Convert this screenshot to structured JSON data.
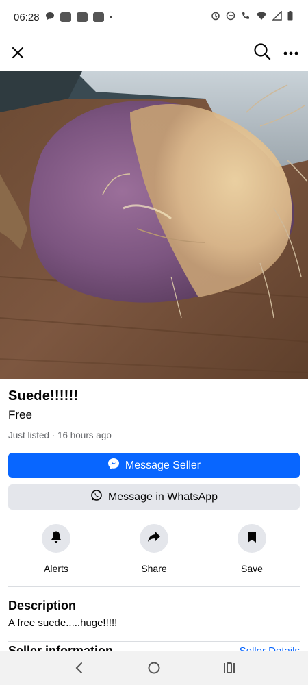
{
  "status_bar": {
    "time": "06:28",
    "left_icons": [
      "chat-bubble-icon",
      "app-notification-icon",
      "app-notification-icon",
      "app-notification-icon",
      "dot-icon"
    ],
    "right_icons": [
      "alarm-icon",
      "do-not-disturb-icon",
      "wifi-call-icon",
      "wifi-icon",
      "signal-icon",
      "battery-icon"
    ]
  },
  "top_bar": {
    "close_icon": "close-icon",
    "search_icon": "search-icon",
    "more_icon": "more-icon"
  },
  "listing": {
    "title": "Suede!!!!!!",
    "price": "Free",
    "listed": "Just listed · 16 hours ago",
    "message_seller_label": "Message Seller",
    "whatsapp_label": "Message in WhatsApp",
    "actions": [
      {
        "label": "Alerts",
        "icon": "bell-icon"
      },
      {
        "label": "Share",
        "icon": "share-icon"
      },
      {
        "label": "Save",
        "icon": "bookmark-icon"
      }
    ],
    "description_title": "Description",
    "description": "A free suede.....huge!!!!!",
    "seller_section_title": "Seller information",
    "seller_details_link": "Seller Details"
  },
  "colors": {
    "primary": "#0866ff",
    "secondary_button": "#e4e6eb",
    "muted_text": "#65676b"
  },
  "nav_bar": {
    "icons": [
      "back-icon",
      "home-icon",
      "recents-icon"
    ]
  }
}
